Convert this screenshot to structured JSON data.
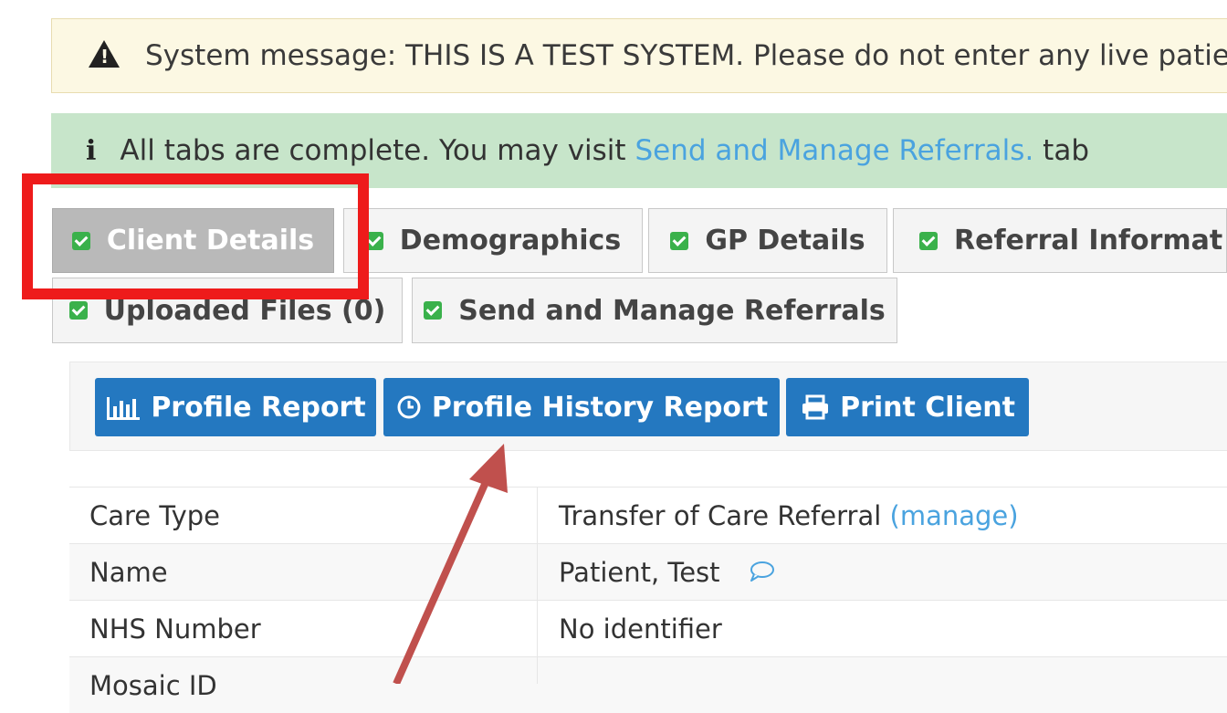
{
  "system_message": "System message: THIS IS A TEST SYSTEM. Please do not enter any live patient",
  "info_message": {
    "prefix": "All tabs are complete. You may visit ",
    "link": "Send and Manage Referrals.",
    "suffix": " tab"
  },
  "tabs": [
    {
      "label": "Client Details",
      "active": true
    },
    {
      "label": "Demographics",
      "active": false
    },
    {
      "label": "GP Details",
      "active": false
    },
    {
      "label": "Referral Informat",
      "active": false
    },
    {
      "label": "Uploaded Files (0)",
      "active": false
    },
    {
      "label": "Send and Manage Referrals",
      "active": false
    }
  ],
  "toolbar": {
    "profile_report": "Profile Report",
    "profile_history_report": "Profile History Report",
    "print_client": "Print Client"
  },
  "details": [
    {
      "label": "Care Type",
      "value": "Transfer of Care Referral",
      "link": "(manage)"
    },
    {
      "label": "Name",
      "value": "Patient, Test"
    },
    {
      "label": "NHS Number",
      "value": "No identifier"
    },
    {
      "label": "Mosaic ID",
      "value": ""
    }
  ],
  "colors": {
    "primary_button": "#2478c0",
    "check_green": "#3ab14b",
    "annotation_red": "#ee1b1b",
    "arrow": "#c0504d",
    "link": "#4aa3df"
  },
  "icons": {
    "warning": "warning-triangle-icon",
    "info": "info-icon",
    "check": "checkbox-checked-icon",
    "chart": "bar-chart-icon",
    "history": "clock-icon",
    "print": "printer-icon",
    "comment": "comment-icon"
  }
}
